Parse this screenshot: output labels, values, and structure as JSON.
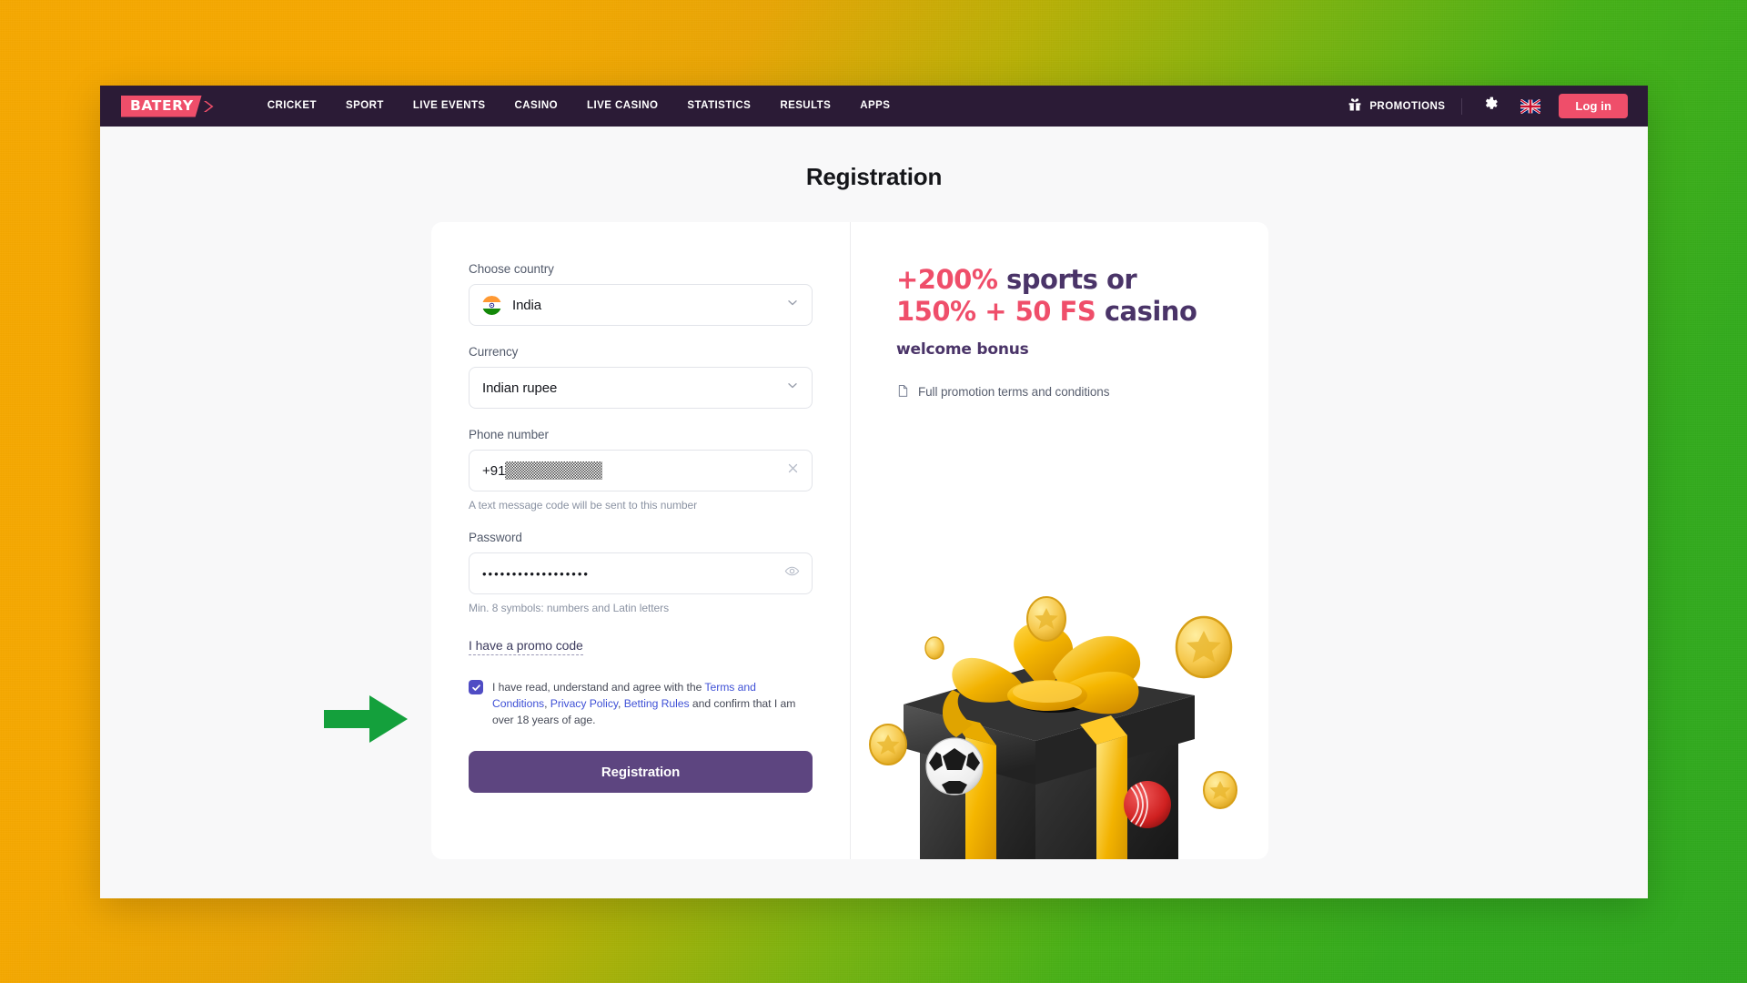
{
  "header": {
    "logo_text": "BATERY",
    "nav_links": [
      {
        "label": "CRICKET"
      },
      {
        "label": "SPORT"
      },
      {
        "label": "LIVE EVENTS"
      },
      {
        "label": "CASINO"
      },
      {
        "label": "LIVE CASINO"
      },
      {
        "label": "STATISTICS"
      },
      {
        "label": "RESULTS"
      },
      {
        "label": "APPS"
      }
    ],
    "promotions_label": "PROMOTIONS",
    "settings_icon": "gear-icon",
    "language_icon": "uk-flag-icon",
    "login_label": "Log in"
  },
  "page": {
    "title": "Registration"
  },
  "form": {
    "country_label": "Choose country",
    "country_value": "India",
    "country_flag": "india-flag-icon",
    "currency_label": "Currency",
    "currency_value": "Indian rupee",
    "phone_label": "Phone number",
    "phone_prefix": "+91",
    "phone_value_redacted": true,
    "phone_hint": "A text message code will be sent to this number",
    "password_label": "Password",
    "password_masked": "••••••••••••••••••",
    "password_hint": "Min. 8 symbols: numbers and Latin letters",
    "promo_code_link": "I have a promo code",
    "terms": {
      "checked": true,
      "part1": "I have read, understand and agree with the ",
      "link1": "Terms and Conditions",
      "sep1": ", ",
      "link2": "Privacy Policy",
      "sep2": ", ",
      "link3": "Betting Rules",
      "part2": " and confirm that I am over 18 years of age."
    },
    "submit_label": "Registration"
  },
  "promo": {
    "line1_highlight": "+200%",
    "line1_rest": " sports or",
    "line2_highlight": "150% + 50 FS",
    "line2_rest": " casino",
    "subtitle": "welcome bonus",
    "terms_link": "Full promotion terms and conditions",
    "terms_icon": "document-icon"
  },
  "annotation": {
    "arrow": "green-arrow-pointing-to-password-field"
  },
  "colors": {
    "nav_bg": "#2b1b36",
    "brand_pink": "#ef4e6a",
    "submit_purple": "#5d4580",
    "promo_purple": "#4a3468",
    "checkbox_blue": "#4f4cc4",
    "link_blue": "#3f51d6",
    "annotation_green": "#14a03c",
    "bg_gradient_from": "#f5a800",
    "bg_gradient_to": "#2fa81f"
  }
}
